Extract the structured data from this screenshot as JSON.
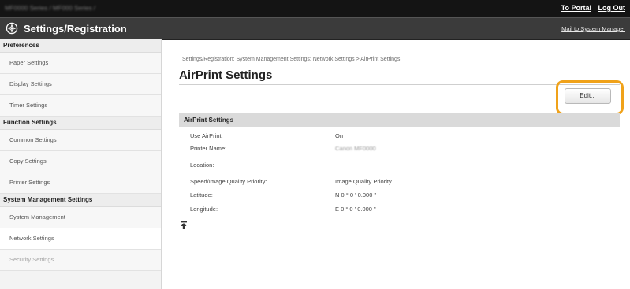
{
  "header": {
    "product_path": "MF0000 Series / MF000 Series /",
    "to_portal": "To Portal",
    "log_out": "Log Out"
  },
  "titlebar": {
    "title": "Settings/Registration",
    "mail_link": "Mail to System Manager"
  },
  "sidebar": {
    "sections": [
      {
        "heading": "Preferences",
        "items": [
          "Paper Settings",
          "Display Settings",
          "Timer Settings"
        ]
      },
      {
        "heading": "Function Settings",
        "items": [
          "Common Settings",
          "Copy Settings",
          "Printer Settings"
        ]
      },
      {
        "heading": "System Management Settings",
        "items": [
          "System Management",
          "Network Settings",
          "Security Settings"
        ]
      }
    ]
  },
  "main": {
    "breadcrumb": "Settings/Registration: System Management Settings: Network Settings > AirPrint Settings",
    "title": "AirPrint Settings",
    "edit_button": "Edit...",
    "section_title": "AirPrint Settings",
    "rows": [
      {
        "label": "Use AirPrint:",
        "value": "On"
      },
      {
        "label": "Printer Name:",
        "value": "Canon MF0000"
      },
      {
        "label": "Location:",
        "value": ""
      },
      {
        "label": "Speed/Image Quality Priority:",
        "value": "Image Quality Priority"
      },
      {
        "label": "Latitude:",
        "value": "N 0 ° 0 ' 0.000 \""
      },
      {
        "label": "Longitude:",
        "value": "E 0 ° 0 ' 0.000 \""
      }
    ]
  },
  "colors": {
    "topbar": "#141414",
    "titlebar": "#3b3b3b",
    "highlight": "#f0a21a",
    "section_bar": "#dadada"
  }
}
